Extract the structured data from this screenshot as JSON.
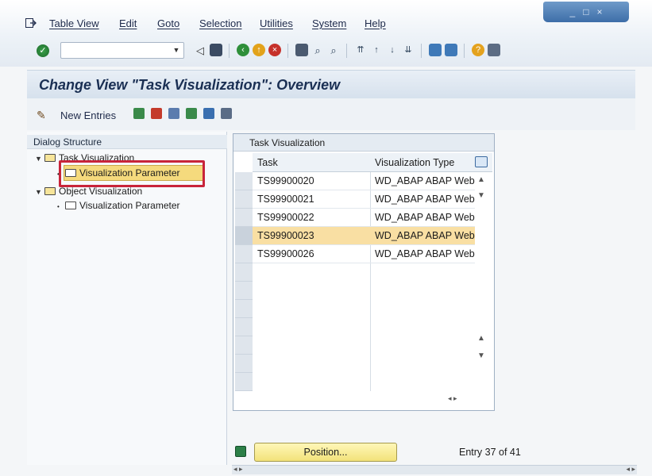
{
  "window": {
    "controls": [
      "_",
      "□",
      "×"
    ]
  },
  "menubar": {
    "items": [
      "Table View",
      "Edit",
      "Goto",
      "Selection",
      "Utilities",
      "System",
      "Help"
    ]
  },
  "toolbar": {
    "command_field_value": ""
  },
  "title": "Change View \"Task Visualization\": Overview",
  "app_toolbar": {
    "new_entries_label": "New Entries"
  },
  "dialog_structure": {
    "header": "Dialog Structure",
    "items": [
      {
        "label": "Task Visualization",
        "level": 0,
        "expanded": true
      },
      {
        "label": "Visualization Parameter",
        "level": 1,
        "selected": true
      },
      {
        "label": "Object Visualization",
        "level": 0,
        "expanded": true
      },
      {
        "label": "Visualization Parameter",
        "level": 1,
        "selected": false
      }
    ]
  },
  "table": {
    "title": "Task Visualization",
    "columns": [
      "Task",
      "Visualization Type"
    ],
    "rows": [
      {
        "task": "TS99900020",
        "type": "WD_ABAP ABAP Web"
      },
      {
        "task": "TS99900021",
        "type": "WD_ABAP ABAP Web"
      },
      {
        "task": "TS99900022",
        "type": "WD_ABAP ABAP Web"
      },
      {
        "task": "TS99900023",
        "type": "WD_ABAP ABAP Web",
        "highlighted": true
      },
      {
        "task": "TS99900026",
        "type": "WD_ABAP ABAP Web"
      }
    ]
  },
  "footer": {
    "position_button_label": "Position...",
    "entry_info": "Entry 37 of 41"
  },
  "colors": {
    "selection_highlight": "#f9dfa3",
    "callout_border": "#c8243a",
    "title_text": "#1a2f53"
  }
}
